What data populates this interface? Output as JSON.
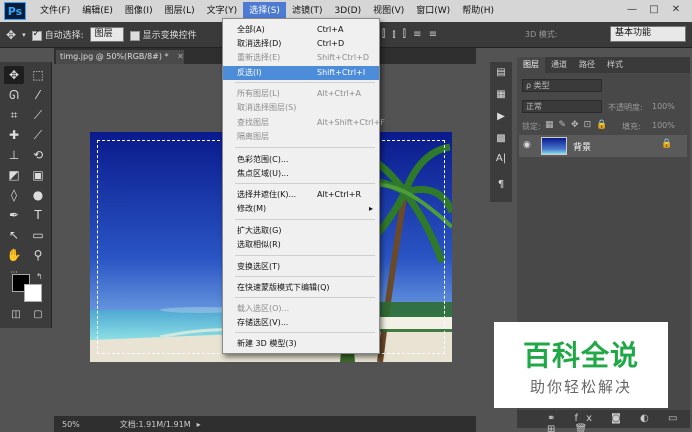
{
  "app": {
    "logo": "Ps"
  },
  "menubar": {
    "items": [
      "文件(F)",
      "编辑(E)",
      "图像(I)",
      "图层(L)",
      "文字(Y)",
      "选择(S)",
      "滤镜(T)",
      "3D(D)",
      "视图(V)",
      "窗口(W)",
      "帮助(H)"
    ],
    "active_index": 5
  },
  "window_controls": {
    "minimize": "—",
    "restore": "□",
    "close": "✕"
  },
  "options_bar": {
    "auto_select_label": "自动选择:",
    "auto_select_value": "图层",
    "show_transform_label": "显示变换控件",
    "mode_3d_label": "3D 模式:",
    "workspace_value": "基本功能"
  },
  "document": {
    "tab_title": "timg.jpg @ 50%(RGB/8#) *",
    "zoom": "50%",
    "doc_info": "文档:1.91M/1.91M"
  },
  "select_menu": {
    "items": [
      {
        "label": "全部(A)",
        "shortcut": "Ctrl+A",
        "state": "normal"
      },
      {
        "label": "取消选择(D)",
        "shortcut": "Ctrl+D",
        "state": "normal"
      },
      {
        "label": "重新选择(E)",
        "shortcut": "Shift+Ctrl+D",
        "state": "disabled"
      },
      {
        "label": "反选(I)",
        "shortcut": "Shift+Ctrl+I",
        "state": "highlighted"
      },
      {
        "label": "所有图层(L)",
        "shortcut": "Alt+Ctrl+A",
        "state": "disabled"
      },
      {
        "label": "取消选择图层(S)",
        "shortcut": "",
        "state": "disabled"
      },
      {
        "label": "查找图层",
        "shortcut": "Alt+Shift+Ctrl+F",
        "state": "disabled"
      },
      {
        "label": "隔离图层",
        "shortcut": "",
        "state": "disabled"
      },
      {
        "label": "色彩范围(C)...",
        "shortcut": "",
        "state": "normal"
      },
      {
        "label": "焦点区域(U)...",
        "shortcut": "",
        "state": "normal"
      },
      {
        "label": "选择并遮住(K)...",
        "shortcut": "Alt+Ctrl+R",
        "state": "normal"
      },
      {
        "label": "修改(M)",
        "shortcut": "▸",
        "state": "normal"
      },
      {
        "label": "扩大选取(G)",
        "shortcut": "",
        "state": "normal"
      },
      {
        "label": "选取相似(R)",
        "shortcut": "",
        "state": "normal"
      },
      {
        "label": "变换选区(T)",
        "shortcut": "",
        "state": "normal"
      },
      {
        "label": "在快速蒙版模式下编辑(Q)",
        "shortcut": "",
        "state": "normal"
      },
      {
        "label": "载入选区(O)...",
        "shortcut": "",
        "state": "disabled"
      },
      {
        "label": "存储选区(V)...",
        "shortcut": "",
        "state": "normal"
      },
      {
        "label": "新建 3D 模型(3)",
        "shortcut": "",
        "state": "normal"
      }
    ]
  },
  "layers_panel": {
    "tabs": [
      "图层",
      "通道",
      "路径",
      "样式"
    ],
    "filter_label": "ρ 类型",
    "blend_mode": "正常",
    "opacity_label": "不透明度:",
    "opacity_value": "100%",
    "lock_label": "锁定:",
    "fill_label": "填充:",
    "fill_value": "100%",
    "layer_name": "背景"
  },
  "watermark": {
    "title": "百科全说",
    "subtitle": "助你轻松解决"
  }
}
